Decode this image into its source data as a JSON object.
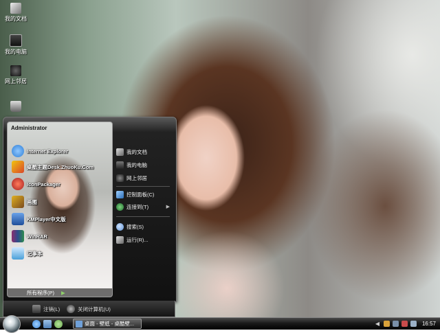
{
  "desktop": {
    "icons": [
      {
        "label": "我的文档",
        "icon": "documents-icon"
      },
      {
        "label": "我的电脑",
        "icon": "computer-icon"
      },
      {
        "label": "网上邻居",
        "icon": "network-icon"
      },
      {
        "label": "",
        "icon": "recycle-bin-icon"
      }
    ]
  },
  "start_menu": {
    "user": "Administrator",
    "programs": [
      {
        "label": "Internet Explorer",
        "icon": "internet-explorer-icon",
        "color": "#2f7fd6"
      },
      {
        "label": "桌酷主题Desk.ZhuoKu.Com",
        "icon": "zhuoku-theme-icon",
        "color": "#d9462a"
      },
      {
        "label": "IconPackager",
        "icon": "iconpackager-icon",
        "color": "#c0392b"
      },
      {
        "label": "画图",
        "icon": "paint-icon",
        "color": "#e0b020"
      },
      {
        "label": "KMPlayer中文版",
        "icon": "kmplayer-icon",
        "color": "#3b6fb8"
      },
      {
        "label": "WinRAR",
        "icon": "winrar-icon",
        "color": "#8b2d6e"
      },
      {
        "label": "记事本",
        "icon": "notepad-icon",
        "color": "#4aa0d8"
      }
    ],
    "all_programs": "所有程序(P)",
    "places": [
      {
        "label": "我的文档",
        "icon": "documents-icon",
        "color": "#9aa0a6"
      },
      {
        "label": "我的电脑",
        "icon": "computer-icon",
        "color": "#7d858c"
      },
      {
        "label": "网上邻居",
        "icon": "network-icon",
        "color": "#6d757c"
      },
      {
        "label": "控制面板(C)",
        "icon": "control-panel-icon",
        "color": "#4a8fd4"
      },
      {
        "label": "连接到(T)",
        "icon": "connect-to-icon",
        "color": "#3fa34d"
      },
      {
        "label": "搜索(S)",
        "icon": "search-icon",
        "color": "#5b8fd0"
      },
      {
        "label": "运行(R)...",
        "icon": "run-icon",
        "color": "#8a9099"
      }
    ],
    "logoff": "注销(L)",
    "shutdown": "关闭计算机(U)"
  },
  "taskbar": {
    "task_label": "桌面 - 壁纸 - 桌酷壁...",
    "clock": "16:57",
    "quicklaunch": [
      {
        "icon": "ie-quicklaunch-icon",
        "color": "#3d86d6"
      },
      {
        "icon": "show-desktop-icon",
        "color": "#4f7fb5"
      },
      {
        "icon": "media-player-icon",
        "color": "#6aa84f"
      }
    ],
    "tray": [
      {
        "icon": "tray-app-icon",
        "color": "#d9a23a"
      },
      {
        "icon": "tray-network-icon",
        "color": "#7a8fa8"
      },
      {
        "icon": "tray-security-icon",
        "color": "#c94b4b"
      },
      {
        "icon": "tray-volume-icon",
        "color": "#9cb1c7"
      }
    ]
  }
}
